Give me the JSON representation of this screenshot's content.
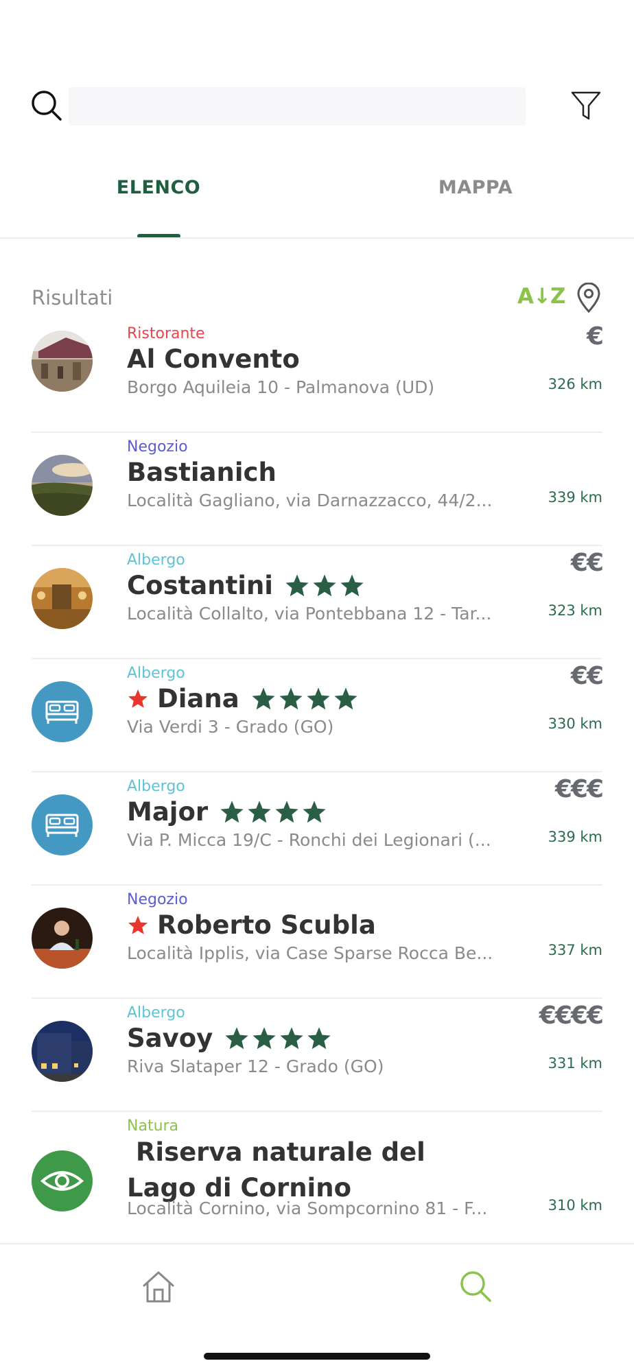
{
  "search": {
    "placeholder": "",
    "value": ""
  },
  "tabs": [
    {
      "label": "ELENCO",
      "active": true
    },
    {
      "label": "MAPPA",
      "active": false
    }
  ],
  "results": {
    "label": "Risultati",
    "sort_label": "A↓Z"
  },
  "colors": {
    "brand_green": "#1f5f3f",
    "accent_green": "#8bc34a",
    "star_green": "#2a5f45",
    "favorite_red": "#e8352e"
  },
  "items": [
    {
      "category": "Ristorante",
      "name": "Al Convento",
      "address": "Borgo Aquileia 10 - Palmanova (UD)",
      "price": "€",
      "distance": "326 km",
      "stars": 0,
      "favorite": false,
      "avatar": "photo-restaurant"
    },
    {
      "category": "Negozio",
      "name": "Bastianich",
      "address": "Località Gagliano, via Darnazzacco, 44/2...",
      "price": "",
      "distance": "339 km",
      "stars": 0,
      "favorite": false,
      "avatar": "photo-vineyard"
    },
    {
      "category": "Albergo",
      "name": "Costantini",
      "address": "Località Collalto, via Pontebbana 12 - Tar...",
      "price": "€€",
      "distance": "323 km",
      "stars": 3,
      "favorite": false,
      "avatar": "photo-hotel-room"
    },
    {
      "category": "Albergo",
      "name": "Diana",
      "address": "Via Verdi 3 - Grado (GO)",
      "price": "€€",
      "distance": "330 km",
      "stars": 4,
      "favorite": true,
      "avatar": "bed-icon"
    },
    {
      "category": "Albergo",
      "name": "Major",
      "address": "Via P. Micca 19/C - Ronchi dei Legionari (...",
      "price": "€€€",
      "distance": "339 km",
      "stars": 4,
      "favorite": false,
      "avatar": "bed-icon"
    },
    {
      "category": "Negozio",
      "name": "Roberto Scubla",
      "address": "Località Ipplis, via Case Sparse Rocca Be...",
      "price": "",
      "distance": "337 km",
      "stars": 0,
      "favorite": true,
      "avatar": "photo-winemaker"
    },
    {
      "category": "Albergo",
      "name": "Savoy",
      "address": "Riva Slataper 12 - Grado (GO)",
      "price": "€€€€",
      "distance": "331 km",
      "stars": 4,
      "favorite": false,
      "avatar": "photo-hotel-night"
    },
    {
      "category": "Natura",
      "name": " Riserva naturale del  Lago di Cornino",
      "address": "Località Cornino, via Sompcornino 81 - F...",
      "price": "",
      "distance": "310 km",
      "stars": 0,
      "favorite": false,
      "avatar": "eye-icon"
    }
  ],
  "bottom_nav": [
    {
      "icon": "home-icon",
      "active": false
    },
    {
      "icon": "search-icon",
      "active": true
    }
  ]
}
